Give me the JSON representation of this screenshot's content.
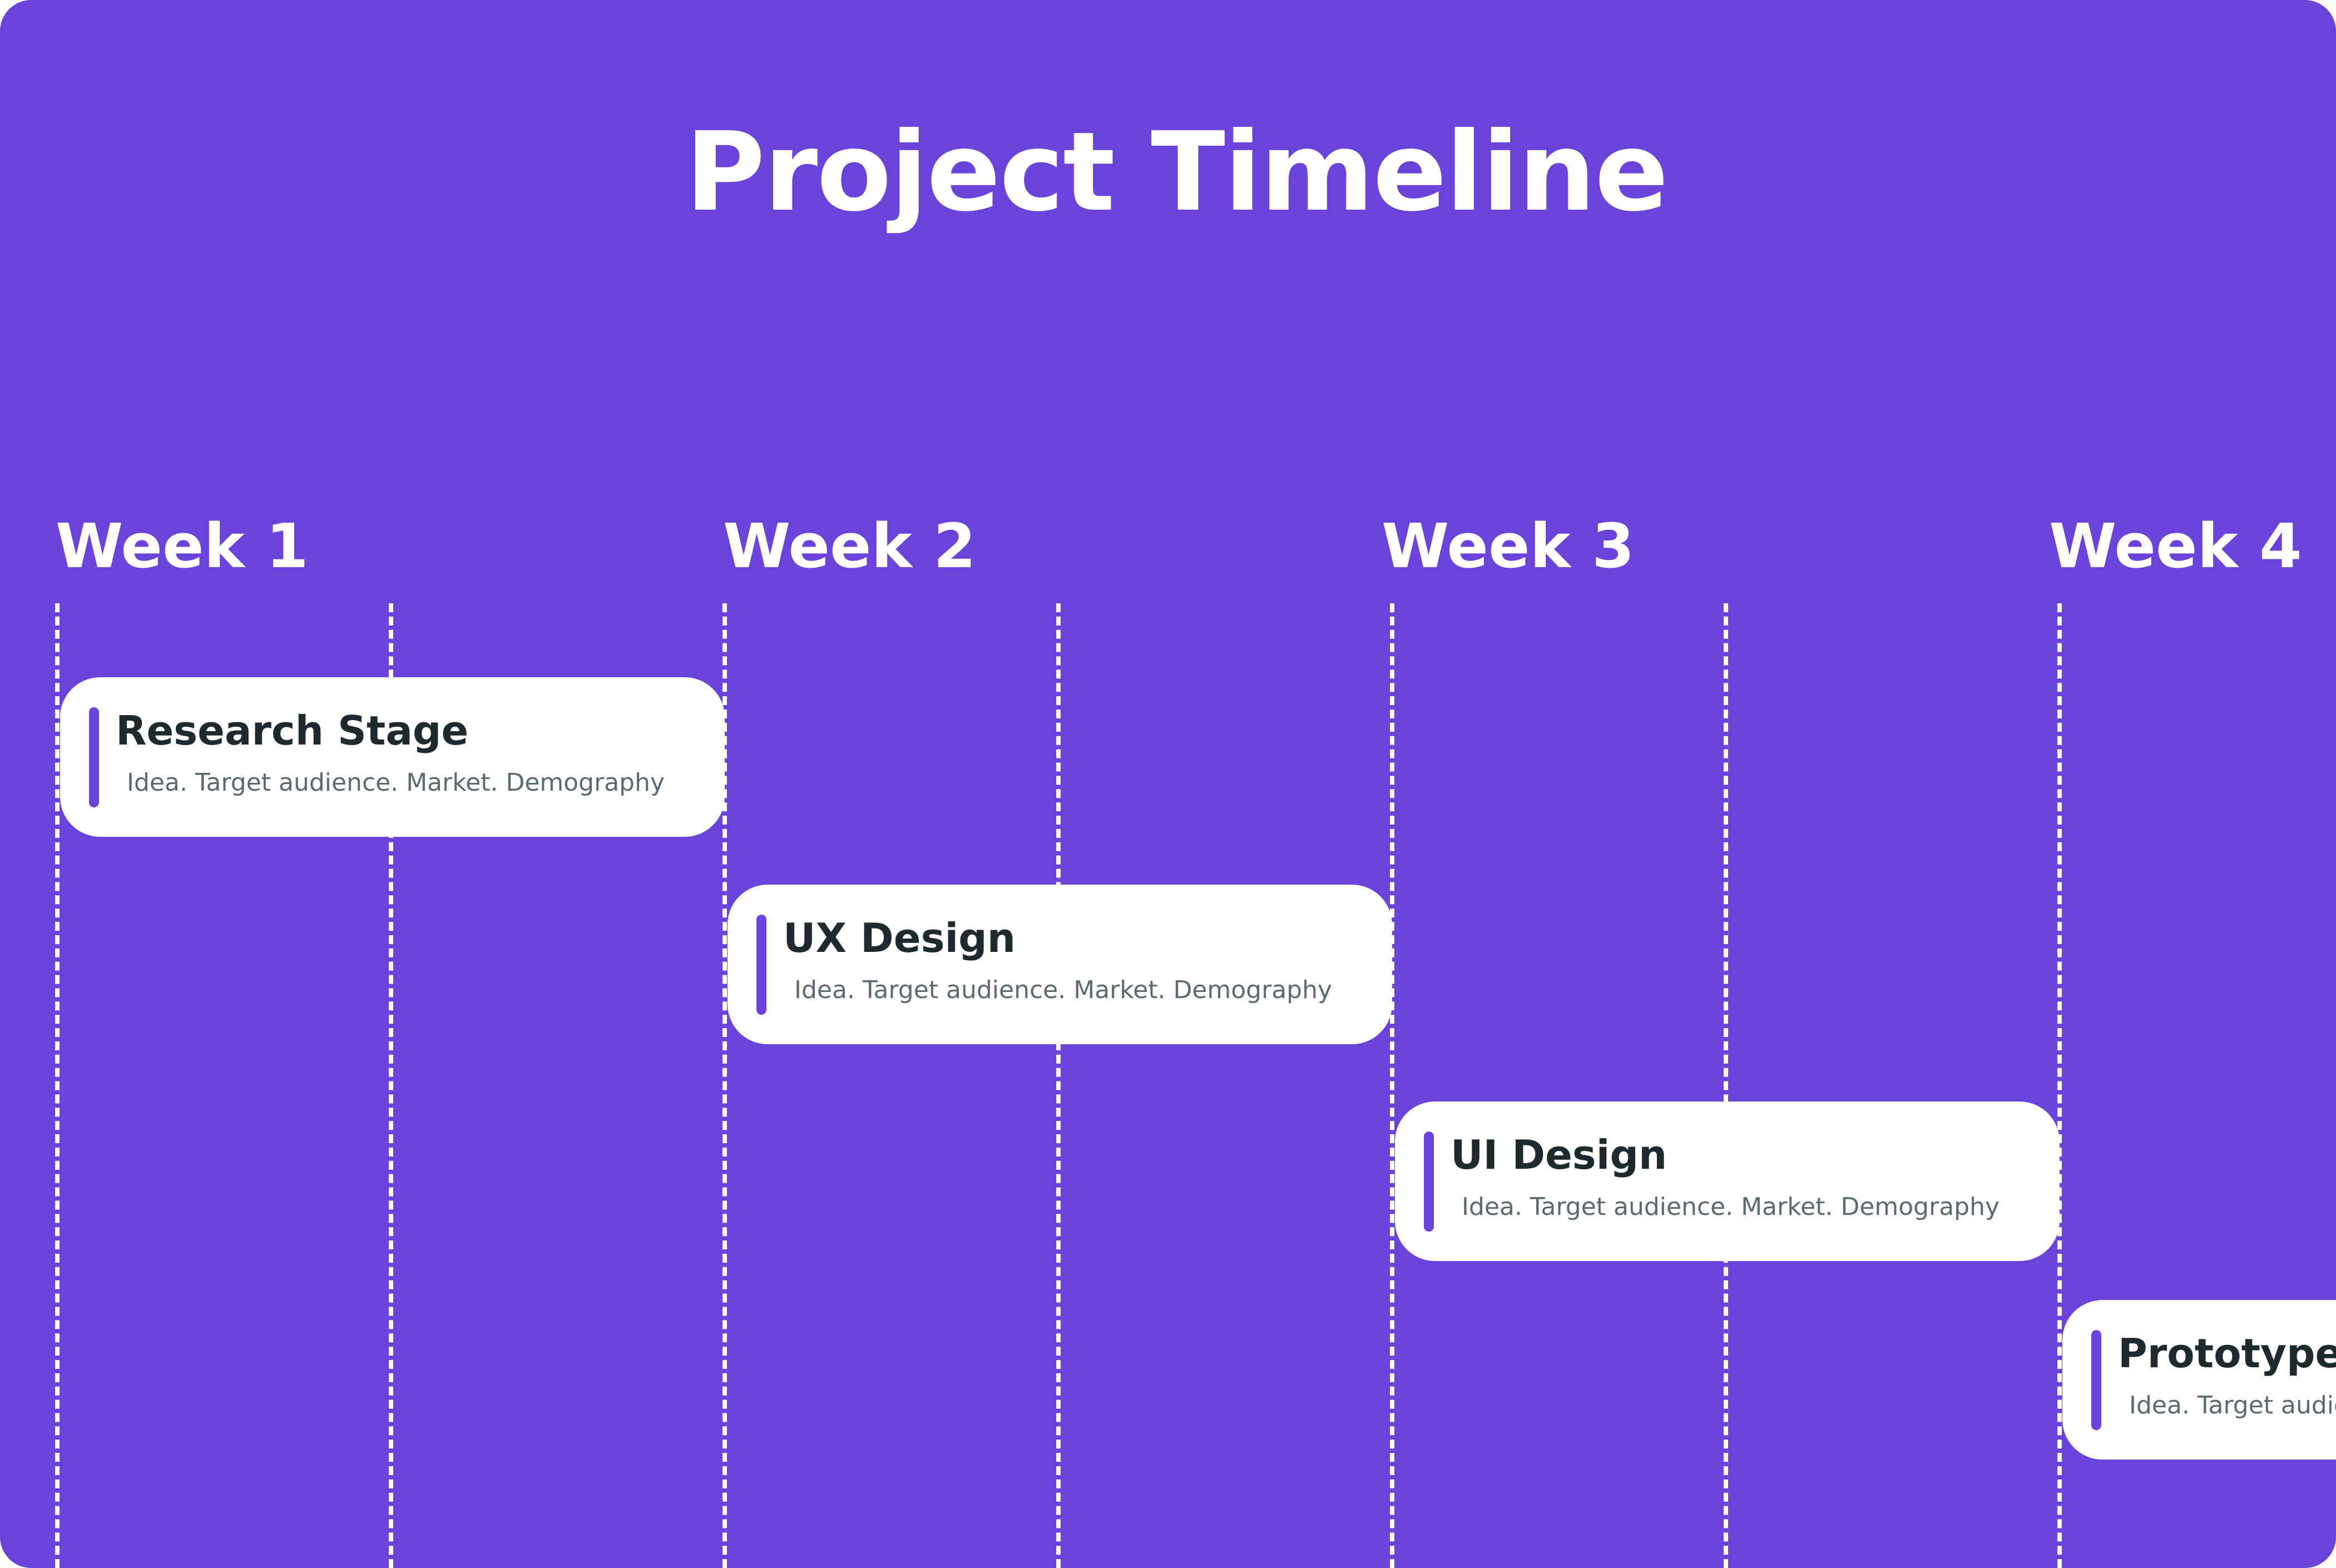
{
  "title": "Project Timeline",
  "weeks": [
    "Week 1",
    "Week 2",
    "Week 3",
    "Week 4"
  ],
  "tasks": [
    {
      "title": "Research Stage",
      "description": "Idea. Target audience. Market. Demography"
    },
    {
      "title": "UX Design",
      "description": "Idea. Target audience. Market. Demography"
    },
    {
      "title": "UI Design",
      "description": "Idea. Target audience. Market. Demography"
    },
    {
      "title": "Prototype",
      "description": "Idea. Target audience. Market. Demography"
    }
  ],
  "colors": {
    "background": "#6b43db",
    "card": "#ffffff",
    "accent": "#6b43db",
    "task_title": "#1f2a2e",
    "task_description": "#5b6a6f",
    "guide": "#ffffff",
    "text": "#ffffff"
  }
}
